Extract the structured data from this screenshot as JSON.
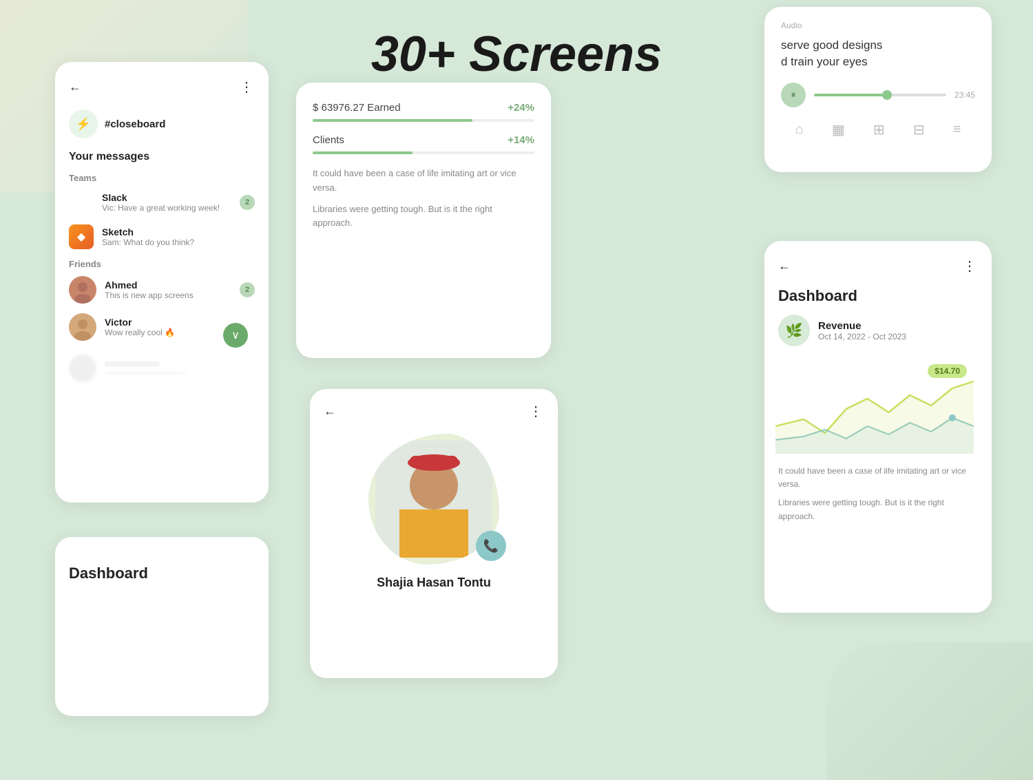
{
  "hero": {
    "title": "30+ Screens"
  },
  "messages_card": {
    "back_label": "←",
    "menu_label": "⋮",
    "channel_icon": "⚡",
    "channel_name": "#closeboard",
    "section_title": "Your messages",
    "teams_label": "Teams",
    "friends_label": "Friends",
    "teams": [
      {
        "name": "Slack",
        "preview": "Vic: Have a great working week!",
        "badge": "2"
      },
      {
        "name": "Sketch",
        "preview": "Sam: What do you think?",
        "badge": ""
      }
    ],
    "friends": [
      {
        "name": "Ahmed",
        "preview": "This is new app screens",
        "badge": "2"
      },
      {
        "name": "Victor",
        "preview": "Wow really cool 🔥",
        "badge": ""
      }
    ],
    "chevron": "∨"
  },
  "stats_card": {
    "earned_label": "$ 63976.27 Earned",
    "earned_value": "+24%",
    "clients_label": "Clients",
    "clients_value": "+14%",
    "text1": "It could have been a case of life imitating art or vice versa.",
    "text2": "Libraries were getting tough. But is it the right approach."
  },
  "audio_card": {
    "section_label": "Audio",
    "title": "serve good designs\nd train your eyes",
    "time": "23:45",
    "nav_icons": [
      "🏠",
      "📅",
      "🗺",
      "🗑",
      "☰"
    ]
  },
  "profile_card": {
    "back_label": "←",
    "menu_label": "⋮",
    "name": "Shajia Hasan Tontu",
    "call_icon": "📞"
  },
  "dashboard_card": {
    "back_label": "←",
    "menu_label": "⋮",
    "title": "Dashboard",
    "revenue_icon": "🌿",
    "revenue_label": "Revenue",
    "revenue_date": "Oct 14, 2022 - Oct 2023",
    "price": "$14.70",
    "text1": "It could have been a case of life imitating art or vice versa.",
    "text2": "Libraries were getting tough. But is it the right approach."
  },
  "bottom_left_card": {
    "title": "Dashboard"
  }
}
